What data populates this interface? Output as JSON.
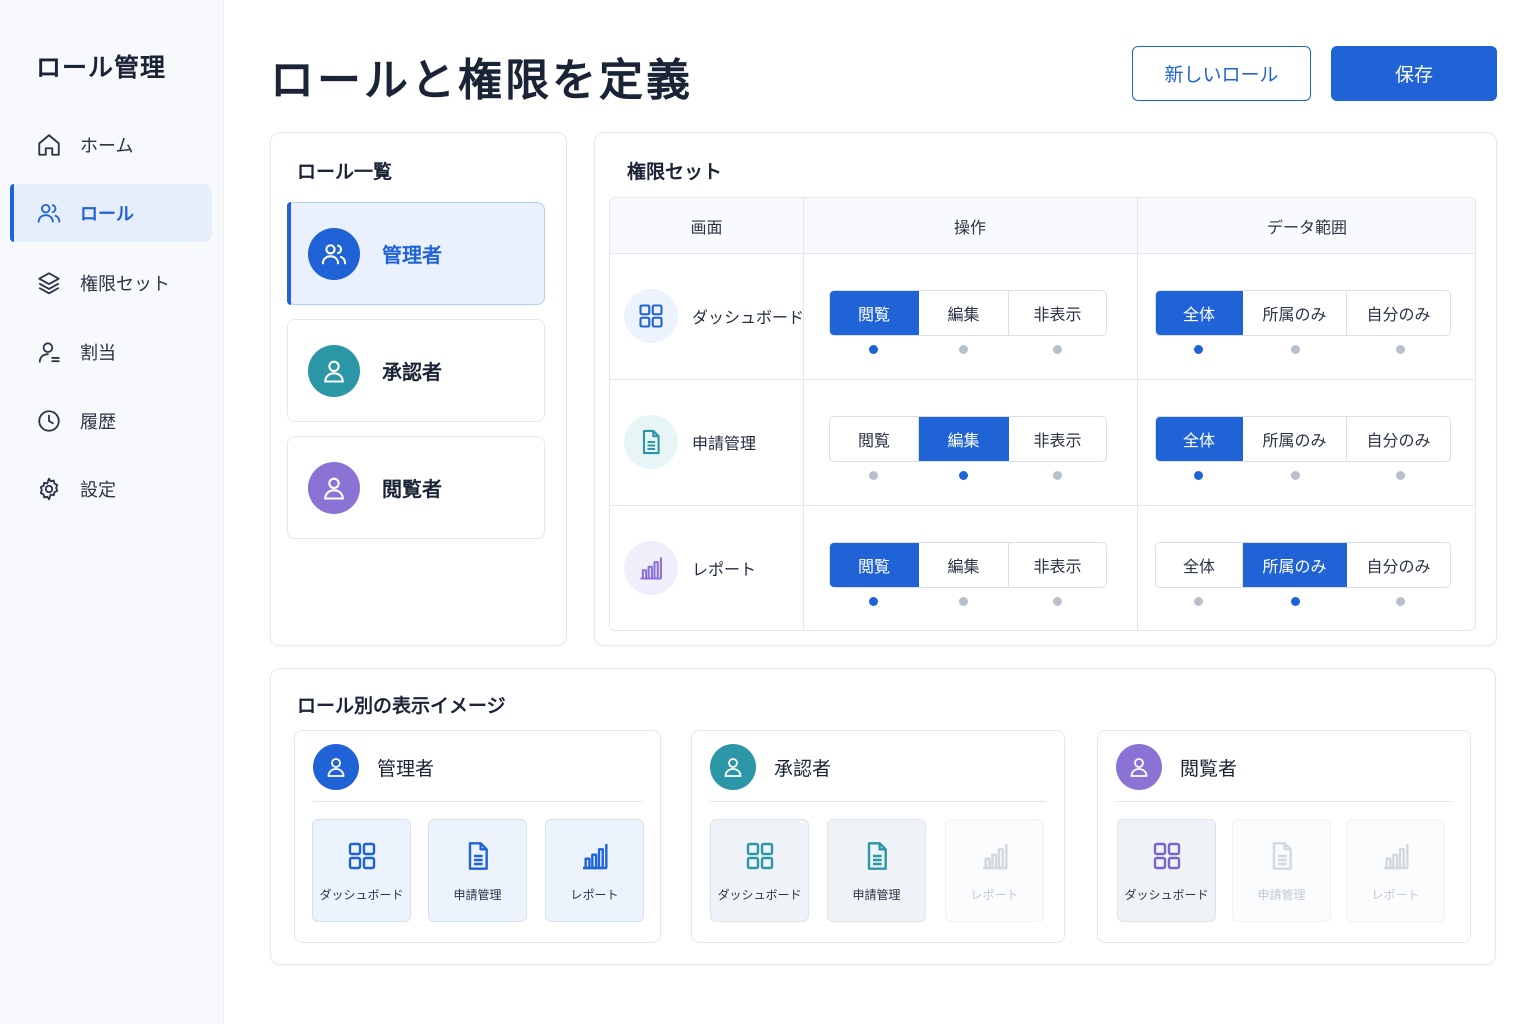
{
  "sidebar": {
    "title": "ロール管理",
    "items": [
      {
        "label": "ホーム",
        "icon": "home-icon"
      },
      {
        "label": "ロール",
        "icon": "users-icon"
      },
      {
        "label": "権限セット",
        "icon": "layers-icon"
      },
      {
        "label": "割当",
        "icon": "user-icon"
      },
      {
        "label": "履歴",
        "icon": "clock-icon"
      },
      {
        "label": "設定",
        "icon": "gear-icon"
      }
    ],
    "active_item": "ロール"
  },
  "header": {
    "title": "ロールと権限を定義",
    "new_role_label": "新しいロール",
    "save_label": "保存"
  },
  "roles_panel": {
    "title": "ロール一覧",
    "roles": [
      {
        "name": "管理者",
        "color": "#1f63d6"
      },
      {
        "name": "承認者",
        "color": "#2a96a6"
      },
      {
        "name": "閲覧者",
        "color": "#8b73d6"
      }
    ],
    "selected": "管理者"
  },
  "permissions": {
    "title": "権限セット",
    "columns": {
      "screen": "画面",
      "operation": "操作",
      "scope": "データ範囲"
    },
    "operation_options": [
      "閲覧",
      "編集",
      "非表示"
    ],
    "scope_options": [
      "全体",
      "所属のみ",
      "自分のみ"
    ],
    "rows": [
      {
        "screen": "ダッシュボード",
        "icon": "dashboard-grid-icon",
        "operation": "閲覧",
        "scope": "全体"
      },
      {
        "screen": "申請管理",
        "icon": "document-icon",
        "operation": "編集",
        "scope": "全体"
      },
      {
        "screen": "レポート",
        "icon": "bar-chart-icon",
        "operation": "閲覧",
        "scope": "所属のみ"
      }
    ]
  },
  "preview": {
    "title": "ロール別の表示イメージ",
    "cards": [
      {
        "role": "管理者",
        "tiles": [
          {
            "label": "ダッシュボード",
            "enabled": true
          },
          {
            "label": "申請管理",
            "enabled": true
          },
          {
            "label": "レポート",
            "enabled": true
          }
        ]
      },
      {
        "role": "承認者",
        "tiles": [
          {
            "label": "ダッシュボード",
            "enabled": true
          },
          {
            "label": "申請管理",
            "enabled": true
          },
          {
            "label": "レポート",
            "enabled": false
          }
        ]
      },
      {
        "role": "閲覧者",
        "tiles": [
          {
            "label": "ダッシュボード",
            "enabled": true
          },
          {
            "label": "申請管理",
            "enabled": false
          },
          {
            "label": "レポート",
            "enabled": false
          }
        ]
      }
    ]
  },
  "colors": {
    "primary": "#1f63d6",
    "teal": "#2a96a6",
    "purple": "#8b73d6",
    "muted": "#b8c0cc"
  }
}
